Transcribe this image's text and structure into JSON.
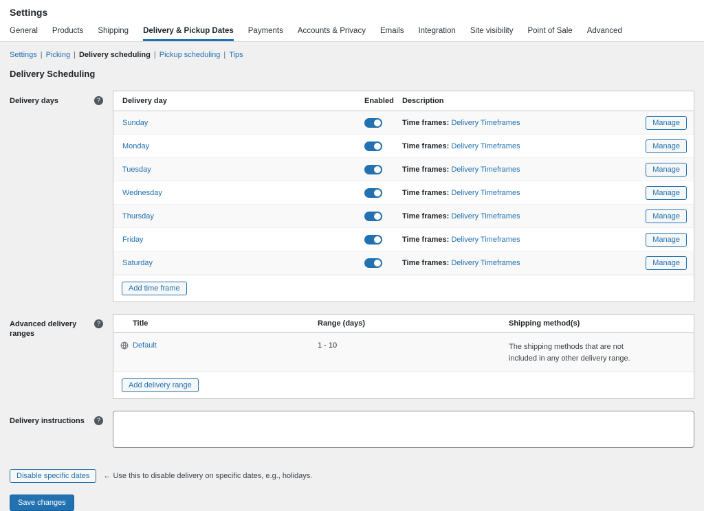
{
  "page": {
    "title": "Settings"
  },
  "tabs": {
    "items": [
      "General",
      "Products",
      "Shipping",
      "Delivery & Pickup Dates",
      "Payments",
      "Accounts & Privacy",
      "Emails",
      "Integration",
      "Site visibility",
      "Point of Sale",
      "Advanced"
    ],
    "active_index": 3
  },
  "subnav": {
    "items": [
      "Settings",
      "Picking",
      "Delivery scheduling",
      "Pickup scheduling",
      "Tips"
    ],
    "active_index": 2,
    "separator": "|"
  },
  "heading": "Delivery Scheduling",
  "delivery_days": {
    "label": "Delivery days",
    "table": {
      "headers": {
        "day": "Delivery day",
        "enabled": "Enabled",
        "description": "Description"
      },
      "rows": [
        {
          "day": "Sunday",
          "enabled": true,
          "desc_prefix": "Time frames:",
          "desc_link": "Delivery Timeframes",
          "action": "Manage"
        },
        {
          "day": "Monday",
          "enabled": true,
          "desc_prefix": "Time frames:",
          "desc_link": "Delivery Timeframes",
          "action": "Manage"
        },
        {
          "day": "Tuesday",
          "enabled": true,
          "desc_prefix": "Time frames:",
          "desc_link": "Delivery Timeframes",
          "action": "Manage"
        },
        {
          "day": "Wednesday",
          "enabled": true,
          "desc_prefix": "Time frames:",
          "desc_link": "Delivery Timeframes",
          "action": "Manage"
        },
        {
          "day": "Thursday",
          "enabled": true,
          "desc_prefix": "Time frames:",
          "desc_link": "Delivery Timeframes",
          "action": "Manage"
        },
        {
          "day": "Friday",
          "enabled": true,
          "desc_prefix": "Time frames:",
          "desc_link": "Delivery Timeframes",
          "action": "Manage"
        },
        {
          "day": "Saturday",
          "enabled": true,
          "desc_prefix": "Time frames:",
          "desc_link": "Delivery Timeframes",
          "action": "Manage"
        }
      ],
      "add_button": "Add time frame"
    }
  },
  "advanced_ranges": {
    "label": "Advanced delivery ranges",
    "table": {
      "headers": {
        "title": "Title",
        "range": "Range (days)",
        "shipping": "Shipping method(s)"
      },
      "rows": [
        {
          "title": "Default",
          "range": "1 - 10",
          "shipping": "The shipping methods that are not included in any other delivery range."
        }
      ],
      "add_button": "Add delivery range"
    }
  },
  "delivery_instructions": {
    "label": "Delivery instructions",
    "value": ""
  },
  "footer": {
    "disable_button": "Disable specific dates",
    "note": "← Use this to disable delivery on specific dates, e.g., holidays.",
    "save_button": "Save changes"
  },
  "colors": {
    "accent": "#2271b1",
    "page_background": "#f0f0f1",
    "panel_border": "#c3c4c7",
    "stripe_row": "#f9f9f9"
  }
}
